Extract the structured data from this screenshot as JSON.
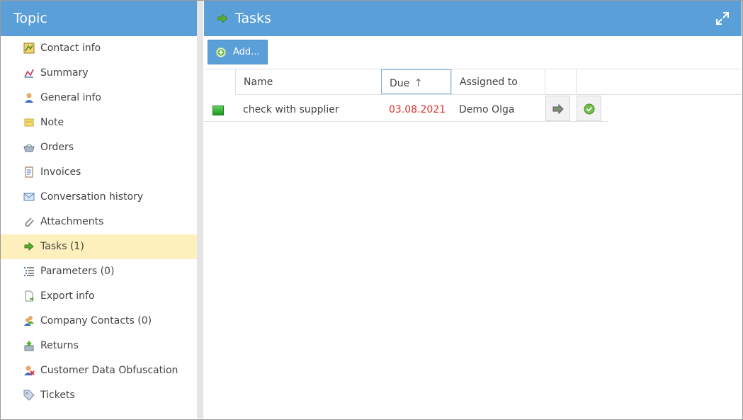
{
  "sidebar": {
    "title": "Topic",
    "items": [
      {
        "label": "Contact info",
        "icon": "contact-card-icon"
      },
      {
        "label": "Summary",
        "icon": "chart-icon"
      },
      {
        "label": "General info",
        "icon": "person-icon"
      },
      {
        "label": "Note",
        "icon": "note-icon"
      },
      {
        "label": "Orders",
        "icon": "basket-icon"
      },
      {
        "label": "Invoices",
        "icon": "invoice-icon"
      },
      {
        "label": "Conversation history",
        "icon": "envelope-icon"
      },
      {
        "label": "Attachments",
        "icon": "paperclip-icon"
      },
      {
        "label": "Tasks (1)",
        "icon": "arrow-right-icon",
        "active": true
      },
      {
        "label": "Parameters (0)",
        "icon": "list-icon"
      },
      {
        "label": "Export info",
        "icon": "export-icon"
      },
      {
        "label": "Company Contacts (0)",
        "icon": "people-icon"
      },
      {
        "label": "Returns",
        "icon": "return-icon"
      },
      {
        "label": "Customer Data Obfuscation",
        "icon": "person-remove-icon"
      },
      {
        "label": "Tickets",
        "icon": "tag-icon"
      }
    ]
  },
  "main": {
    "title": "Tasks",
    "add_label": "Add...",
    "columns": {
      "name": "Name",
      "due": "Due",
      "due_sort": "↑",
      "assigned": "Assigned to"
    },
    "rows": [
      {
        "name": "check with supplier",
        "due": "03.08.2021",
        "assigned": "Demo Olga",
        "status_color": "#2aa52a"
      }
    ]
  },
  "colors": {
    "accent": "#5b9fd8",
    "active_item": "#fdf0bd",
    "overdue": "#e03030"
  }
}
